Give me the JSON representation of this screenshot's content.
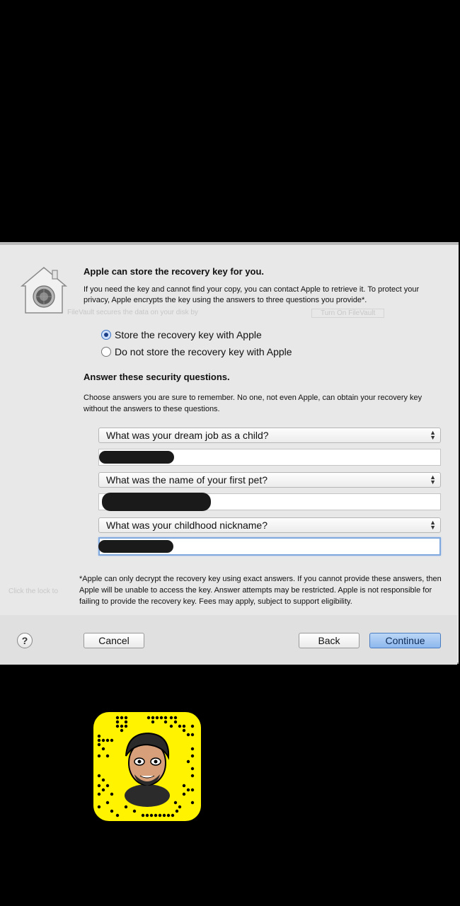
{
  "dialog": {
    "title": "Apple can store the recovery key for you.",
    "description": "If you need the key and cannot find your copy, you can contact Apple to retrieve it. To protect your privacy, Apple encrypts the key using the answers to three questions you provide*.",
    "options": [
      {
        "label": "Store the recovery key with Apple",
        "selected": true
      },
      {
        "label": "Do not store the recovery key with Apple",
        "selected": false
      }
    ],
    "security_title": "Answer these security questions.",
    "security_description": "Choose answers you are sure to remember. No one, not even Apple, can obtain your recovery key without the answers to these questions.",
    "questions": [
      {
        "question": "What was your dream job as a child?",
        "answer_redacted": true
      },
      {
        "question": "What was the name of your first pet?",
        "answer_redacted": true
      },
      {
        "question": "What was your childhood nickname?",
        "answer_redacted": true
      }
    ],
    "footnote": "*Apple can only decrypt the recovery key using exact answers. If you cannot provide these answers, then Apple will be unable to access the key. Answer attempts may be restricted. Apple is not responsible for failing to provide the recovery key. Fees may apply, subject to support eligibility.",
    "buttons": {
      "help": "?",
      "cancel": "Cancel",
      "back": "Back",
      "continue": "Continue"
    }
  },
  "icons": {
    "dialog_icon": "filevault-house-icon",
    "snapcode": "snapcode-bitmoji-icon"
  },
  "colors": {
    "accent": "#3d73c4",
    "primary_button": "#8db8ee",
    "snapcode_yellow": "#fff300"
  }
}
